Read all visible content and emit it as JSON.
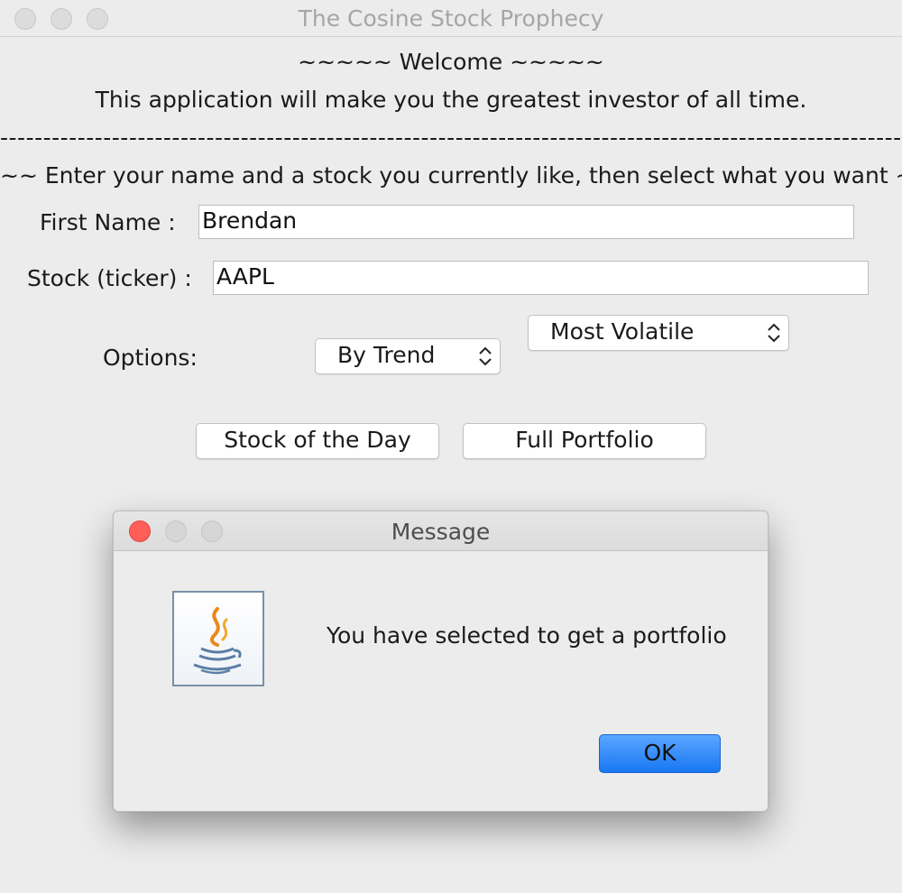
{
  "window": {
    "title": "The Cosine Stock Prophecy"
  },
  "header": {
    "welcome": "~~~~~ Welcome ~~~~~",
    "tagline": "This application will make you the greatest investor of all time.",
    "divider": "-------------------------------------------------------------------------------------------------------------------",
    "instructions": "~~ Enter your name and a stock you currently like, then select what you want ~~"
  },
  "form": {
    "first_name_label": "First Name :",
    "first_name_value": "Brendan",
    "stock_label": "Stock (ticker) :",
    "stock_value": "AAPL",
    "options_label": "Options:",
    "trend_select": "By Trend",
    "volatility_select": "Most Volatile"
  },
  "actions": {
    "stock_of_day": "Stock of the Day",
    "full_portfolio": "Full Portfolio"
  },
  "dialog": {
    "title": "Message",
    "icon": "java-icon",
    "message": "You have selected to get a portfolio",
    "ok_label": "OK"
  },
  "colors": {
    "window_bg": "#ececec",
    "close_red": "#ff5f57",
    "ok_blue": "#1877f2"
  }
}
